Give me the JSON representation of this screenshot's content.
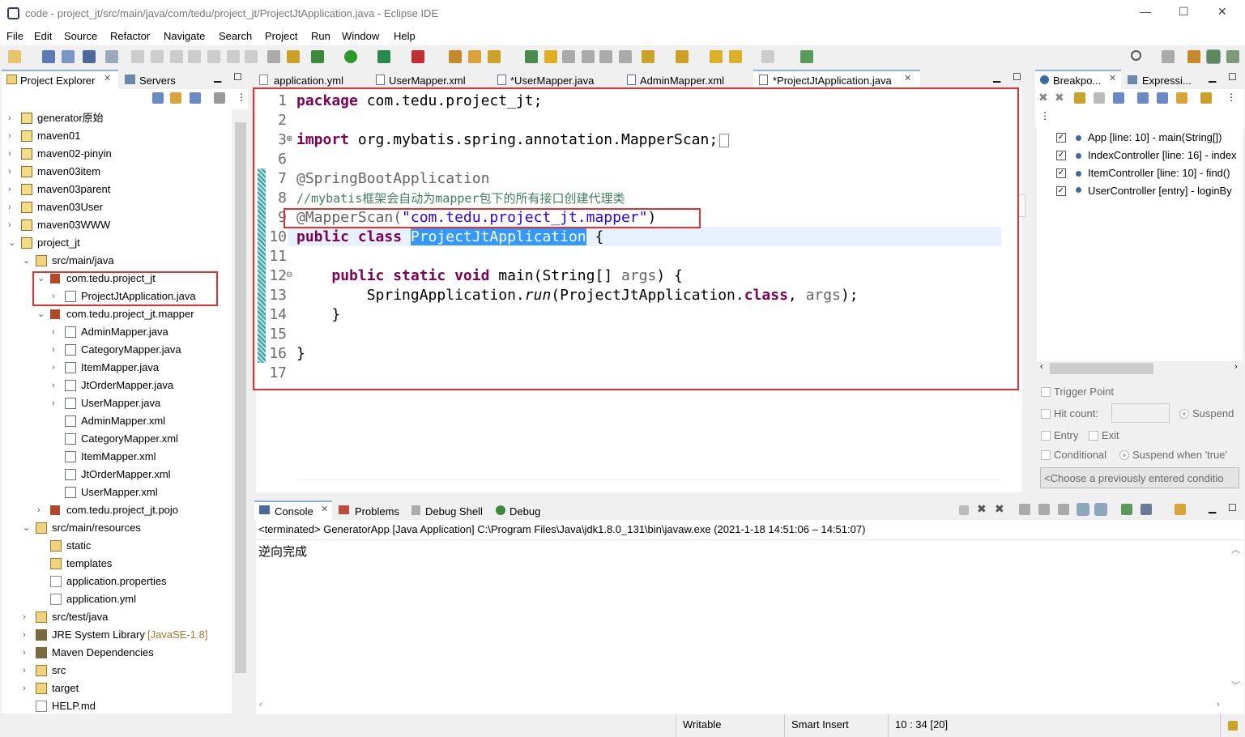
{
  "window": {
    "title": "code - project_jt/src/main/java/com/tedu/project_jt/ProjectJtApplication.java - Eclipse IDE",
    "minimize": "—",
    "maximize": "☐",
    "close": "✕"
  },
  "menu": [
    "File",
    "Edit",
    "Source",
    "Refactor",
    "Navigate",
    "Search",
    "Project",
    "Run",
    "Window",
    "Help"
  ],
  "left_tabs": {
    "explorer": "Project Explorer",
    "servers": "Servers"
  },
  "tree": [
    {
      "label": "generator原始",
      "depth": 0,
      "icon": "project",
      "twist": "›"
    },
    {
      "label": "maven01",
      "depth": 0,
      "icon": "project",
      "twist": "›"
    },
    {
      "label": "maven02-pinyin",
      "depth": 0,
      "icon": "project",
      "twist": "›"
    },
    {
      "label": "maven03item",
      "depth": 0,
      "icon": "project",
      "twist": "›"
    },
    {
      "label": "maven03parent",
      "depth": 0,
      "icon": "project",
      "twist": "›"
    },
    {
      "label": "maven03User",
      "depth": 0,
      "icon": "project",
      "twist": "›"
    },
    {
      "label": "maven03WWW",
      "depth": 0,
      "icon": "project",
      "twist": "›"
    },
    {
      "label": "project_jt",
      "depth": 0,
      "icon": "project",
      "twist": "⌄"
    },
    {
      "label": "src/main/java",
      "depth": 1,
      "icon": "folder",
      "twist": "⌄"
    },
    {
      "label": "com.tedu.project_jt",
      "depth": 2,
      "icon": "pkg",
      "twist": "⌄"
    },
    {
      "label": "ProjectJtApplication.java",
      "depth": 3,
      "icon": "java",
      "twist": "›"
    },
    {
      "label": "com.tedu.project_jt.mapper",
      "depth": 2,
      "icon": "pkg",
      "twist": "⌄"
    },
    {
      "label": "AdminMapper.java",
      "depth": 3,
      "icon": "java",
      "twist": "›"
    },
    {
      "label": "CategoryMapper.java",
      "depth": 3,
      "icon": "java",
      "twist": "›"
    },
    {
      "label": "ItemMapper.java",
      "depth": 3,
      "icon": "java",
      "twist": "›"
    },
    {
      "label": "JtOrderMapper.java",
      "depth": 3,
      "icon": "java",
      "twist": "›"
    },
    {
      "label": "UserMapper.java",
      "depth": 3,
      "icon": "java",
      "twist": "›"
    },
    {
      "label": "AdminMapper.xml",
      "depth": 3,
      "icon": "xml",
      "twist": ""
    },
    {
      "label": "CategoryMapper.xml",
      "depth": 3,
      "icon": "xml",
      "twist": ""
    },
    {
      "label": "ItemMapper.xml",
      "depth": 3,
      "icon": "xml",
      "twist": ""
    },
    {
      "label": "JtOrderMapper.xml",
      "depth": 3,
      "icon": "xml",
      "twist": ""
    },
    {
      "label": "UserMapper.xml",
      "depth": 3,
      "icon": "xml",
      "twist": ""
    },
    {
      "label": "com.tedu.project_jt.pojo",
      "depth": 2,
      "icon": "pkg",
      "twist": "›"
    },
    {
      "label": "src/main/resources",
      "depth": 1,
      "icon": "folder",
      "twist": "⌄"
    },
    {
      "label": "static",
      "depth": 2,
      "icon": "folder",
      "twist": ""
    },
    {
      "label": "templates",
      "depth": 2,
      "icon": "folder",
      "twist": ""
    },
    {
      "label": "application.properties",
      "depth": 2,
      "icon": "file",
      "twist": ""
    },
    {
      "label": "application.yml",
      "depth": 2,
      "icon": "file",
      "twist": ""
    },
    {
      "label": "src/test/java",
      "depth": 1,
      "icon": "folder",
      "twist": "›"
    },
    {
      "label": "JRE System Library",
      "depth": 1,
      "icon": "lib",
      "twist": "›",
      "suffix": "[JavaSE-1.8]"
    },
    {
      "label": "Maven Dependencies",
      "depth": 1,
      "icon": "lib",
      "twist": "›"
    },
    {
      "label": "src",
      "depth": 1,
      "icon": "folder",
      "twist": "›"
    },
    {
      "label": "target",
      "depth": 1,
      "icon": "folder",
      "twist": "›"
    },
    {
      "label": "HELP.md",
      "depth": 1,
      "icon": "file",
      "twist": ""
    }
  ],
  "editor_tabs": [
    "application.yml",
    "UserMapper.xml",
    "*UserMapper.java",
    "AdminMapper.xml",
    "*ProjectJtApplication.java"
  ],
  "code": {
    "line_numbers": [
      "1",
      "2",
      "3",
      "6",
      "7",
      "8",
      "9",
      "10",
      "11",
      "12",
      "13",
      "14",
      "15",
      "16",
      "17"
    ],
    "l1_kw": "package",
    "l1_rest": " com.tedu.project_jt;",
    "l3_kw": "import",
    "l3_rest": " org.mybatis.spring.annotation.MapperScan;",
    "l7": "@SpringBootApplication",
    "l8": "//mybatis框架会自动为mapper包下的所有接口创建代理类",
    "l9_ann": "@MapperScan(",
    "l9_str": "\"com.tedu.project_jt.mapper\"",
    "l9_end": ")",
    "l10_kw": "public class",
    "l10_name": "ProjectJtApplication",
    "l10_end": " {",
    "l12_kw": "public static void",
    "l12_rest": " main(String[] ",
    "l12_arg": "args",
    "l12_end": ") {",
    "l13_a": "SpringApplication.",
    "l13_run": "run",
    "l13_b": "(ProjectJtApplication.",
    "l13_cls": "class",
    "l13_c": ", ",
    "l13_arg": "args",
    "l13_d": ");",
    "l14": "}",
    "l16": "}"
  },
  "right_tabs": {
    "breakpoints": "Breakpo...",
    "expressions": "Expressi..."
  },
  "breakpoints": [
    "App [line: 10] - main(String[])",
    "IndexController [line: 16] - index",
    "ItemController [line: 10] - find()",
    "UserController [entry] - loginBy"
  ],
  "bp_options": {
    "trigger": "Trigger Point",
    "hit": "Hit count:",
    "suspend": "Suspend",
    "entry": "Entry",
    "exit": "Exit",
    "conditional": "Conditional",
    "suspend_true": "Suspend when 'true'",
    "choose": "<Choose a previously entered conditio"
  },
  "console_tabs": [
    "Console",
    "Problems",
    "Debug Shell",
    "Debug"
  ],
  "console": {
    "header": "<terminated> GeneratorApp [Java Application] C:\\Program Files\\Java\\jdk1.8.0_131\\bin\\javaw.exe  (2021-1-18 14:51:06 – 14:51:07)",
    "output": "逆向完成"
  },
  "status": {
    "writable": "Writable",
    "insert": "Smart Insert",
    "position": "10 : 34 [20]"
  }
}
